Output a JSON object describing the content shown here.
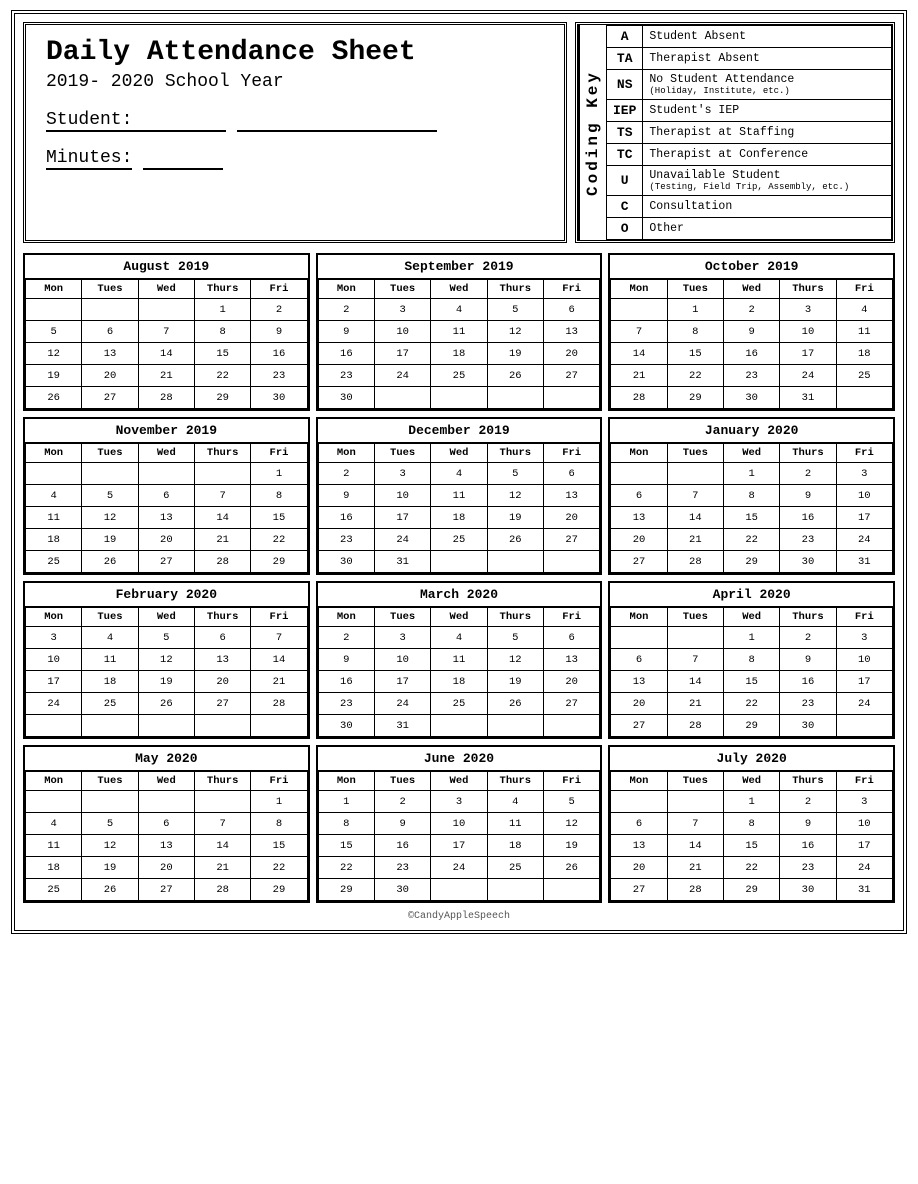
{
  "header": {
    "title": "Daily Attendance Sheet",
    "school_year": "2019- 2020 School Year",
    "student_label": "Student:",
    "minutes_label": "Minutes:"
  },
  "coding_key": {
    "section_label": "Coding Key",
    "items": [
      {
        "code": "A",
        "description": "Student Absent",
        "sub": ""
      },
      {
        "code": "TA",
        "description": "Therapist Absent",
        "sub": ""
      },
      {
        "code": "NS",
        "description": "No Student Attendance",
        "sub": "(Holiday, Institute, etc.)"
      },
      {
        "code": "IEP",
        "description": "Student's IEP",
        "sub": ""
      },
      {
        "code": "TS",
        "description": "Therapist at Staffing",
        "sub": ""
      },
      {
        "code": "TC",
        "description": "Therapist at Conference",
        "sub": ""
      },
      {
        "code": "U",
        "description": "Unavailable Student",
        "sub": "(Testing, Field Trip, Assembly, etc.)"
      },
      {
        "code": "C",
        "description": "Consultation",
        "sub": ""
      },
      {
        "code": "O",
        "description": "Other",
        "sub": ""
      }
    ]
  },
  "calendars": [
    {
      "title": "August 2019",
      "headers": [
        "Mon",
        "Tues",
        "Wed",
        "Thurs",
        "Fri"
      ],
      "weeks": [
        [
          "",
          "",
          "",
          "1",
          "2"
        ],
        [
          "5",
          "6",
          "7",
          "8",
          "9"
        ],
        [
          "12",
          "13",
          "14",
          "15",
          "16"
        ],
        [
          "19",
          "20",
          "21",
          "22",
          "23"
        ],
        [
          "26",
          "27",
          "28",
          "29",
          "30"
        ]
      ]
    },
    {
      "title": "September 2019",
      "headers": [
        "Mon",
        "Tues",
        "Wed",
        "Thurs",
        "Fri"
      ],
      "weeks": [
        [
          "2",
          "3",
          "4",
          "5",
          "6"
        ],
        [
          "9",
          "10",
          "11",
          "12",
          "13"
        ],
        [
          "16",
          "17",
          "18",
          "19",
          "20"
        ],
        [
          "23",
          "24",
          "25",
          "26",
          "27"
        ],
        [
          "30",
          "",
          "",
          "",
          ""
        ]
      ]
    },
    {
      "title": "October 2019",
      "headers": [
        "Mon",
        "Tues",
        "Wed",
        "Thurs",
        "Fri"
      ],
      "weeks": [
        [
          "",
          "1",
          "2",
          "3",
          "4"
        ],
        [
          "7",
          "8",
          "9",
          "10",
          "11"
        ],
        [
          "14",
          "15",
          "16",
          "17",
          "18"
        ],
        [
          "21",
          "22",
          "23",
          "24",
          "25"
        ],
        [
          "28",
          "29",
          "30",
          "31",
          ""
        ]
      ]
    },
    {
      "title": "November 2019",
      "headers": [
        "Mon",
        "Tues",
        "Wed",
        "Thurs",
        "Fri"
      ],
      "weeks": [
        [
          "",
          "",
          "",
          "",
          "1"
        ],
        [
          "4",
          "5",
          "6",
          "7",
          "8"
        ],
        [
          "11",
          "12",
          "13",
          "14",
          "15"
        ],
        [
          "18",
          "19",
          "20",
          "21",
          "22"
        ],
        [
          "25",
          "26",
          "27",
          "28",
          "29"
        ]
      ]
    },
    {
      "title": "December 2019",
      "headers": [
        "Mon",
        "Tues",
        "Wed",
        "Thurs",
        "Fri"
      ],
      "weeks": [
        [
          "2",
          "3",
          "4",
          "5",
          "6"
        ],
        [
          "9",
          "10",
          "11",
          "12",
          "13"
        ],
        [
          "16",
          "17",
          "18",
          "19",
          "20"
        ],
        [
          "23",
          "24",
          "25",
          "26",
          "27"
        ],
        [
          "30",
          "31",
          "",
          "",
          ""
        ]
      ]
    },
    {
      "title": "January 2020",
      "headers": [
        "Mon",
        "Tues",
        "Wed",
        "Thurs",
        "Fri"
      ],
      "weeks": [
        [
          "",
          "",
          "1",
          "2",
          "3"
        ],
        [
          "6",
          "7",
          "8",
          "9",
          "10"
        ],
        [
          "13",
          "14",
          "15",
          "16",
          "17"
        ],
        [
          "20",
          "21",
          "22",
          "23",
          "24"
        ],
        [
          "27",
          "28",
          "29",
          "30",
          "31"
        ]
      ]
    },
    {
      "title": "February 2020",
      "headers": [
        "Mon",
        "Tues",
        "Wed",
        "Thurs",
        "Fri"
      ],
      "weeks": [
        [
          "3",
          "4",
          "5",
          "6",
          "7"
        ],
        [
          "10",
          "11",
          "12",
          "13",
          "14"
        ],
        [
          "17",
          "18",
          "19",
          "20",
          "21"
        ],
        [
          "24",
          "25",
          "26",
          "27",
          "28"
        ],
        [
          "",
          "",
          "",
          "",
          ""
        ]
      ]
    },
    {
      "title": "March 2020",
      "headers": [
        "Mon",
        "Tues",
        "Wed",
        "Thurs",
        "Fri"
      ],
      "weeks": [
        [
          "2",
          "3",
          "4",
          "5",
          "6"
        ],
        [
          "9",
          "10",
          "11",
          "12",
          "13"
        ],
        [
          "16",
          "17",
          "18",
          "19",
          "20"
        ],
        [
          "23",
          "24",
          "25",
          "26",
          "27"
        ],
        [
          "30",
          "31",
          "",
          "",
          ""
        ]
      ]
    },
    {
      "title": "April 2020",
      "headers": [
        "Mon",
        "Tues",
        "Wed",
        "Thurs",
        "Fri"
      ],
      "weeks": [
        [
          "",
          "",
          "1",
          "2",
          "3"
        ],
        [
          "6",
          "7",
          "8",
          "9",
          "10"
        ],
        [
          "13",
          "14",
          "15",
          "16",
          "17"
        ],
        [
          "20",
          "21",
          "22",
          "23",
          "24"
        ],
        [
          "27",
          "28",
          "29",
          "30",
          ""
        ]
      ]
    },
    {
      "title": "May 2020",
      "headers": [
        "Mon",
        "Tues",
        "Wed",
        "Thurs",
        "Fri"
      ],
      "weeks": [
        [
          "",
          "",
          "",
          "",
          "1"
        ],
        [
          "4",
          "5",
          "6",
          "7",
          "8"
        ],
        [
          "11",
          "12",
          "13",
          "14",
          "15"
        ],
        [
          "18",
          "19",
          "20",
          "21",
          "22"
        ],
        [
          "25",
          "26",
          "27",
          "28",
          "29"
        ]
      ]
    },
    {
      "title": "June 2020",
      "headers": [
        "Mon",
        "Tues",
        "Wed",
        "Thurs",
        "Fri"
      ],
      "weeks": [
        [
          "1",
          "2",
          "3",
          "4",
          "5"
        ],
        [
          "8",
          "9",
          "10",
          "11",
          "12"
        ],
        [
          "15",
          "16",
          "17",
          "18",
          "19"
        ],
        [
          "22",
          "23",
          "24",
          "25",
          "26"
        ],
        [
          "29",
          "30",
          "",
          "",
          ""
        ]
      ]
    },
    {
      "title": "July 2020",
      "headers": [
        "Mon",
        "Tues",
        "Wed",
        "Thurs",
        "Fri"
      ],
      "weeks": [
        [
          "",
          "",
          "1",
          "2",
          "3"
        ],
        [
          "6",
          "7",
          "8",
          "9",
          "10"
        ],
        [
          "13",
          "14",
          "15",
          "16",
          "17"
        ],
        [
          "20",
          "21",
          "22",
          "23",
          "24"
        ],
        [
          "27",
          "28",
          "29",
          "30",
          "31"
        ]
      ]
    }
  ],
  "footer": "©CandyAppleSpeech"
}
